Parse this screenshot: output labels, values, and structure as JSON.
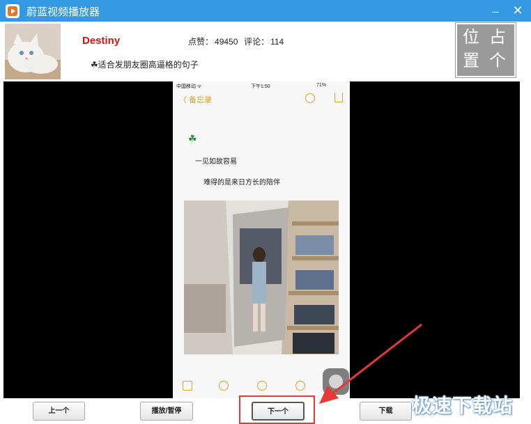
{
  "window": {
    "title": "蔚蓝视频播放器",
    "close_glyph": "✕"
  },
  "header": {
    "username": "Destiny",
    "likes_label": "点赞：",
    "likes_value": "49450",
    "comments_label": "评论：",
    "comments_value": "114",
    "description": "☘适合发朋友圈高逼格的句子",
    "seal_chars": [
      "位",
      "占",
      "置",
      "个"
    ]
  },
  "phone_screen": {
    "carrier": "中国移动 ᯤ",
    "time": "下午1:50",
    "battery": "71%",
    "back_label": "〈 备忘录",
    "clover": "☘",
    "line1": "一见如故容易",
    "line2": "难得的是来日方长的陪伴"
  },
  "controls": {
    "prev_label": "上一个",
    "play_pause_label": "播放/暂停",
    "next_label": "下一个",
    "download_label": "下载"
  },
  "watermark": "极速下载站",
  "colors": {
    "titlebar": "#3399e3",
    "username": "#e01010",
    "highlight": "#e53935",
    "notes_accent": "#e0a020"
  }
}
